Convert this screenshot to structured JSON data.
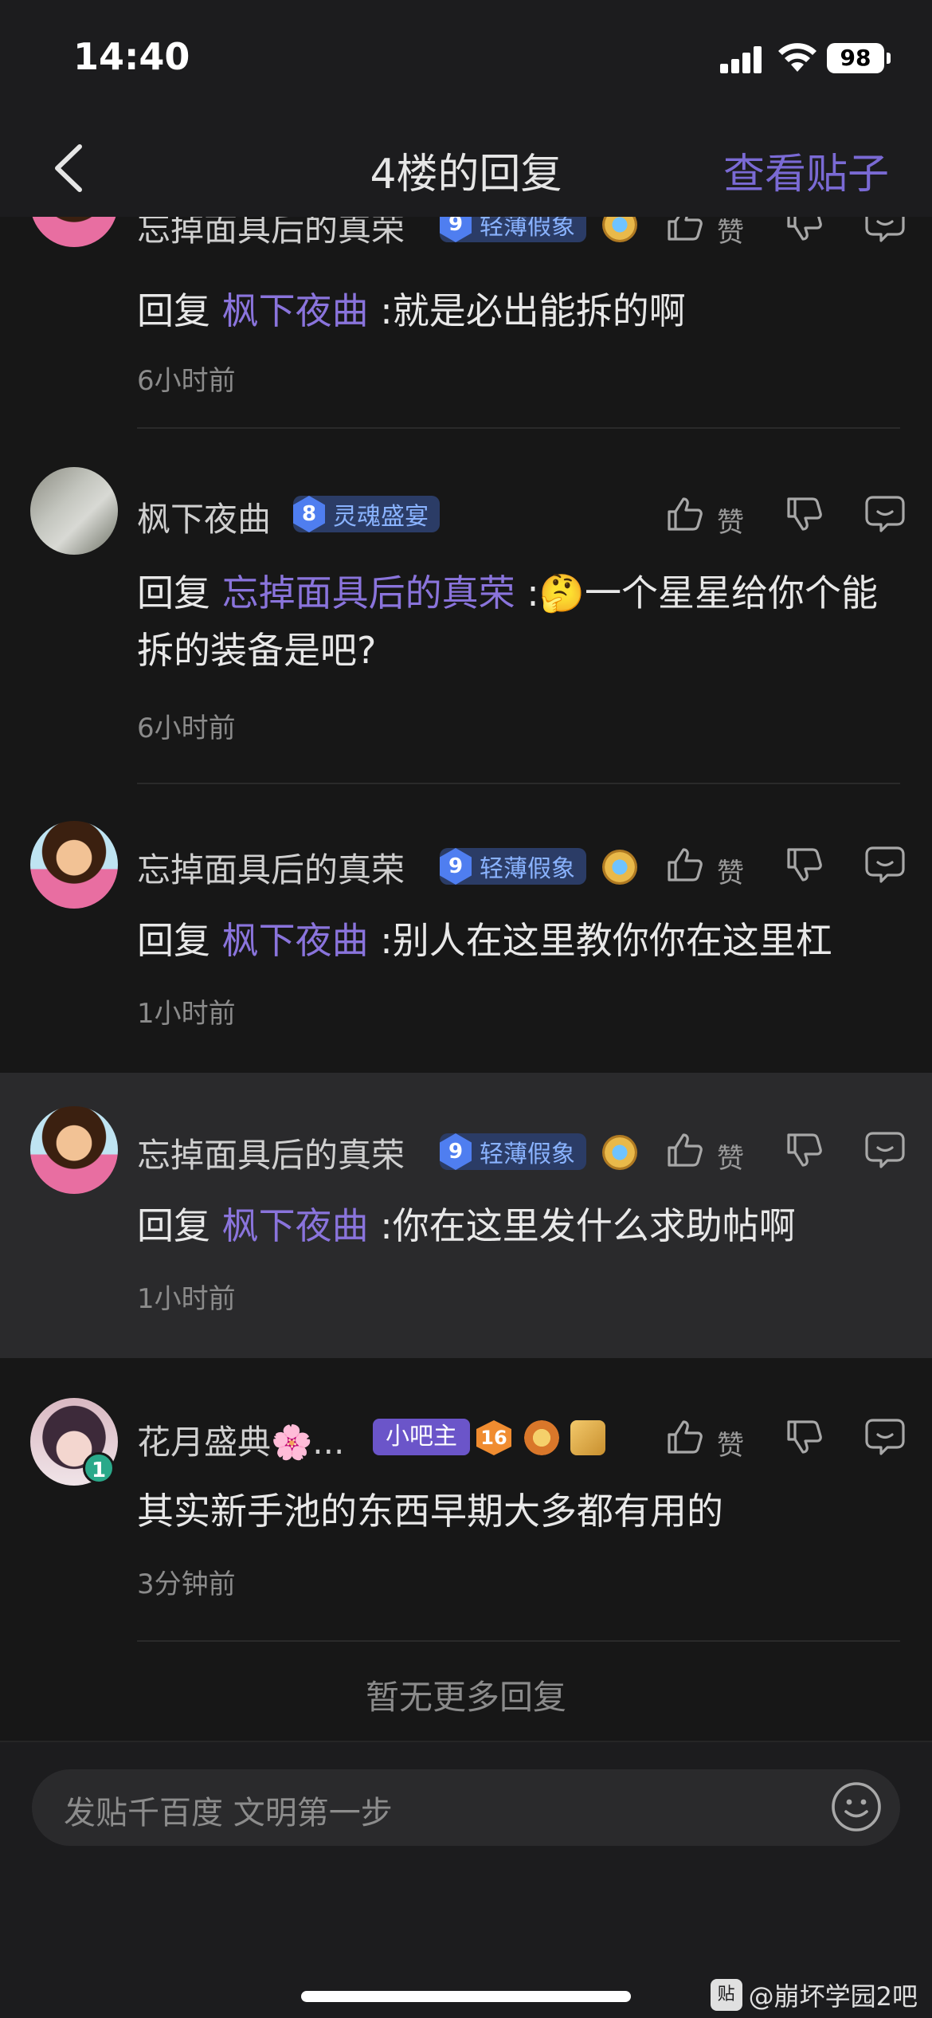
{
  "status_bar": {
    "time": "14:40",
    "battery": "98"
  },
  "nav": {
    "title": "4楼的回复",
    "view_post": "查看贴子"
  },
  "like_label": "赞",
  "comments": [
    {
      "username": "忘掉面具后的真荣",
      "level": "9",
      "badge": "轻薄假象",
      "prefix": "回复",
      "mention": "枫下夜曲",
      "text": ":就是必出能拆的啊",
      "time": "6小时前"
    },
    {
      "username": "枫下夜曲",
      "level": "8",
      "badge": "灵魂盛宴",
      "prefix": "回复",
      "mention": "忘掉面具后的真荣",
      "text": ":🤔一个星星给你个能拆的装备是吧?",
      "time": "6小时前"
    },
    {
      "username": "忘掉面具后的真荣",
      "level": "9",
      "badge": "轻薄假象",
      "prefix": "回复",
      "mention": "枫下夜曲",
      "text": ":别人在这里教你你在这里杠",
      "time": "1小时前"
    },
    {
      "username": "忘掉面具后的真荣",
      "level": "9",
      "badge": "轻薄假象",
      "prefix": "回复",
      "mention": "枫下夜曲",
      "text": ":你在这里发什么求助帖啊",
      "time": "1小时前"
    },
    {
      "username": "花月盛典🌸...",
      "owner_badge": "小吧主",
      "level": "16",
      "avatar_level": "1",
      "text": "其实新手池的东西早期大多都有用的",
      "time": "3分钟前"
    }
  ],
  "no_more": "暂无更多回复",
  "input": {
    "placeholder": "发贴千百度 文明第一步"
  },
  "watermark": {
    "icon": "贴",
    "text": "@崩坏学园2吧"
  }
}
